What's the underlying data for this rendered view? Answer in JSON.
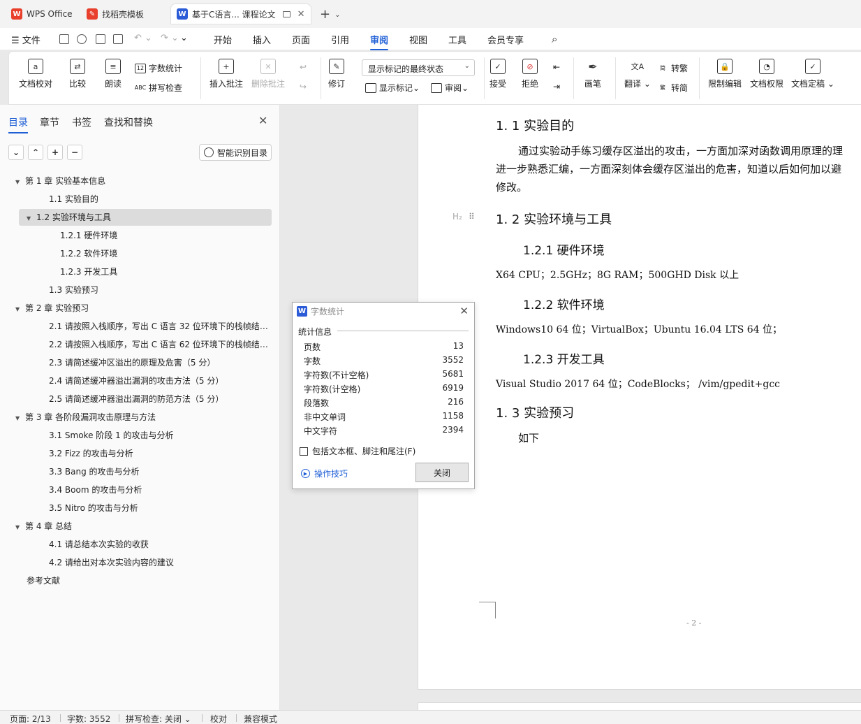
{
  "tabs": [
    {
      "label": "WPS Office",
      "icon": "wps-icon",
      "color": "#e8402c"
    },
    {
      "label": "找稻壳模板",
      "icon": "docer-icon",
      "color": "#e8402c"
    },
    {
      "label": "基于C语言... 课程论文",
      "icon": "writer-icon",
      "color": "#2b5bd7"
    }
  ],
  "menu": {
    "file": "文件",
    "items": [
      "开始",
      "插入",
      "页面",
      "引用",
      "审阅",
      "视图",
      "工具",
      "会员专享"
    ],
    "active": "审阅"
  },
  "ribbon": {
    "doc_check": "文档校对",
    "compare": "比较",
    "read_aloud": "朗读",
    "word_count": "字数统计",
    "spell_check": "拼写检查",
    "insert_comment": "插入批注",
    "delete_comment": "删除批注",
    "revise": "修订",
    "markup_select": "显示标记的最终状态",
    "show_markup": "显示标记",
    "review_pane": "审阅",
    "accept": "接受",
    "reject": "拒绝",
    "ink": "画笔",
    "translate": "翻译",
    "trad": "转繁",
    "simp": "转简",
    "restrict": "限制编辑",
    "permission": "文档权限",
    "finalize": "文档定稿"
  },
  "nav": {
    "tabs": [
      "目录",
      "章节",
      "书签",
      "查找和替换"
    ],
    "active_tab": "目录",
    "smart_button": "智能识别目录",
    "toc": [
      {
        "label": "第 1 章  实验基本信息",
        "level": 1,
        "expand": true
      },
      {
        "label": "1.1  实验目的",
        "level": 2
      },
      {
        "label": "1.2 实验环境与工具",
        "level": 2,
        "expand": true,
        "selected": true
      },
      {
        "label": "1.2.1  硬件环境",
        "level": 3
      },
      {
        "label": "1.2.2  软件环境",
        "level": 3
      },
      {
        "label": "1.2.3  开发工具",
        "level": 3
      },
      {
        "label": "1.3  实验预习",
        "level": 2
      },
      {
        "label": "第 2 章  实验预习",
        "level": 1,
        "expand": true
      },
      {
        "label": "2.1  请按照入栈顺序，写出 C 语言 32 位环境下的栈帧结构（5 分）",
        "level": 2
      },
      {
        "label": "2.2 请按照入栈顺序，写出 C 语言 62 位环境下的栈帧结构（5 分）",
        "level": 2
      },
      {
        "label": "2.3 请简述缓冲区溢出的原理及危害（5 分）",
        "level": 2
      },
      {
        "label": "2.4 请简述缓冲器溢出漏洞的攻击方法（5 分）",
        "level": 2
      },
      {
        "label": "2.5 请简述缓冲器溢出漏洞的防范方法（5 分）",
        "level": 2
      },
      {
        "label": "第 3 章  各阶段漏洞攻击原理与方法",
        "level": 1,
        "expand": true
      },
      {
        "label": "3.1 Smoke 阶段 1 的攻击与分析",
        "level": 2
      },
      {
        "label": "3.2 Fizz 的攻击与分析",
        "level": 2
      },
      {
        "label": "3.3 Bang 的攻击与分析",
        "level": 2
      },
      {
        "label": "3.4 Boom 的攻击与分析",
        "level": 2
      },
      {
        "label": "3.5 Nitro 的攻击与分析",
        "level": 2
      },
      {
        "label": "第 4 章  总结",
        "level": 1,
        "expand": true
      },
      {
        "label": "4.1  请总结本次实验的收获",
        "level": 2
      },
      {
        "label": "4.2  请给出对本次实验内容的建议",
        "level": 2
      },
      {
        "label": "参考文献",
        "level": 1
      }
    ]
  },
  "document": {
    "h_1_1": "1. 1  实验目的",
    "para_1": "通过实验动手练习缓存区溢出的攻击，一方面加深对函数调用原理的理",
    "para_2": "进一步熟悉汇编，一方面深刻体会缓存区溢出的危害，知道以后如何加以避",
    "para_3": "修改。",
    "h2_marker": "H₂",
    "h_1_2": "1. 2 实验环境与工具",
    "h_1_2_1": "1.2.1  硬件环境",
    "hw": "X64 CPU；2.5GHz；8G RAM；500GHD Disk  以上",
    "h_1_2_2": "1.2.2  软件环境",
    "sw": "Windows10 64 位；VirtualBox；Ubuntu 16.04 LTS 64 位；",
    "h_1_2_3": "1.2.3  开发工具",
    "tools": "Visual Studio 2017 64 位；CodeBlocks；   /vim/gpedit+gcc",
    "h_1_3": "1. 3  实验预习",
    "para_below": "如下",
    "page_number": "- 2 -"
  },
  "dialog": {
    "title": "字数统计",
    "section": "统计信息",
    "stats": [
      {
        "label": "页数",
        "value": "13"
      },
      {
        "label": "字数",
        "value": "3552"
      },
      {
        "label": "字符数(不计空格)",
        "value": "5681"
      },
      {
        "label": "字符数(计空格)",
        "value": "6919"
      },
      {
        "label": "段落数",
        "value": "216"
      },
      {
        "label": "非中文单词",
        "value": "1158"
      },
      {
        "label": "中文字符",
        "value": "2394"
      }
    ],
    "checkbox": "包括文本框、脚注和尾注(F)",
    "tips": "操作技巧",
    "close": "关闭"
  },
  "status": {
    "page": "页面: 2/13",
    "words": "字数: 3552",
    "spell": "拼写检查: 关闭",
    "proof": "校对",
    "compat": "兼容模式"
  },
  "colors": {
    "accent": "#1f5fd6",
    "wps_red": "#e8402c",
    "writer_blue": "#2b5bd7"
  }
}
